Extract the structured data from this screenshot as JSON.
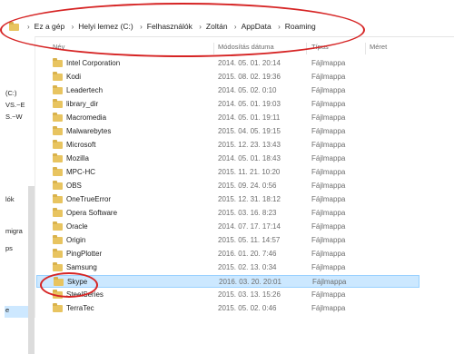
{
  "breadcrumb": {
    "items": [
      "Ez a gép",
      "Helyi lemez (C:)",
      "Felhasználók",
      "Zoltán",
      "AppData",
      "Roaming"
    ]
  },
  "columns": {
    "name": "Név",
    "date": "Módosítás dátuma",
    "type": "Típus",
    "size": "Méret"
  },
  "nav": {
    "items": [
      "(C:)",
      "VS.~E",
      "S.~W",
      "lók",
      "migra",
      "ps",
      "e"
    ]
  },
  "files": [
    {
      "name": "Intel Corporation",
      "date": "2014. 05. 01. 20:14",
      "type": "Fájlmappa"
    },
    {
      "name": "Kodi",
      "date": "2015. 08. 02. 19:36",
      "type": "Fájlmappa"
    },
    {
      "name": "Leadertech",
      "date": "2014. 05. 02. 0:10",
      "type": "Fájlmappa"
    },
    {
      "name": "library_dir",
      "date": "2014. 05. 01. 19:03",
      "type": "Fájlmappa"
    },
    {
      "name": "Macromedia",
      "date": "2014. 05. 01. 19:11",
      "type": "Fájlmappa"
    },
    {
      "name": "Malwarebytes",
      "date": "2015. 04. 05. 19:15",
      "type": "Fájlmappa"
    },
    {
      "name": "Microsoft",
      "date": "2015. 12. 23. 13:43",
      "type": "Fájlmappa"
    },
    {
      "name": "Mozilla",
      "date": "2014. 05. 01. 18:43",
      "type": "Fájlmappa"
    },
    {
      "name": "MPC-HC",
      "date": "2015. 11. 21. 10:20",
      "type": "Fájlmappa"
    },
    {
      "name": "OBS",
      "date": "2015. 09. 24. 0:56",
      "type": "Fájlmappa"
    },
    {
      "name": "OneTrueError",
      "date": "2015. 12. 31. 18:12",
      "type": "Fájlmappa"
    },
    {
      "name": "Opera Software",
      "date": "2015. 03. 16. 8:23",
      "type": "Fájlmappa"
    },
    {
      "name": "Oracle",
      "date": "2014. 07. 17. 17:14",
      "type": "Fájlmappa"
    },
    {
      "name": "Origin",
      "date": "2015. 05. 11. 14:57",
      "type": "Fájlmappa"
    },
    {
      "name": "PingPlotter",
      "date": "2016. 01. 20. 7:46",
      "type": "Fájlmappa"
    },
    {
      "name": "Samsung",
      "date": "2015. 02. 13. 0:34",
      "type": "Fájlmappa"
    },
    {
      "name": "Skype",
      "date": "2016. 03. 20. 20:01",
      "type": "Fájlmappa",
      "selected": true
    },
    {
      "name": "SteelSeries",
      "date": "2015. 03. 13. 15:26",
      "type": "Fájlmappa"
    },
    {
      "name": "TerraTec",
      "date": "2015. 05. 02. 0:46",
      "type": "Fájlmappa"
    }
  ]
}
